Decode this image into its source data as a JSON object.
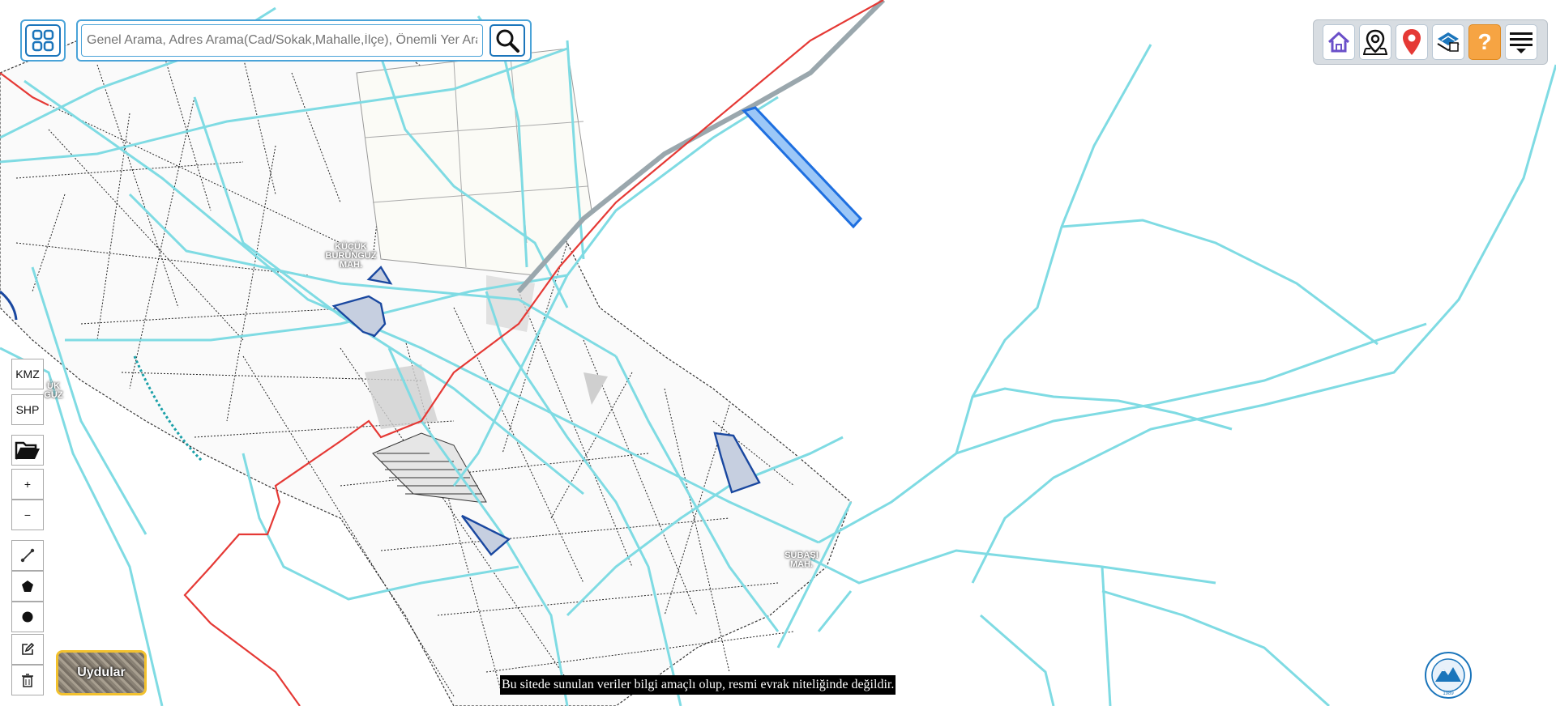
{
  "search": {
    "placeholder": "Genel Arama, Adres Arama(Cad/Sokak,Mahalle,İlçe), Önemli Yer Arama"
  },
  "toolbar": {
    "icons": [
      "home-icon",
      "map-pin-outline-icon",
      "location-pin-icon",
      "layers-icon",
      "help-icon",
      "menu-icon"
    ],
    "help_label": "?"
  },
  "left_controls": {
    "kmz_label": "KMZ",
    "shp_label": "SHP",
    "zoom_in_label": "+",
    "zoom_out_label": "−"
  },
  "basemap": {
    "button_label": "Uydular"
  },
  "map": {
    "labels": {
      "kucuk_buruncuz": "KÜÇÜK BURUNGUZ MAH.",
      "subasi": "SUBAŞI MAH.",
      "edge_fragment": "ÜK GÜZ"
    },
    "colors": {
      "roads": "#7fdbe3",
      "boundary": "#e53935",
      "parcels": "#222222",
      "selection": "#1565c0",
      "highlight_fill": "#9cc7f7"
    }
  },
  "disclaimer": "Bu sitede sunulan veriler bilgi amaçlı olup, resmi evrak niteliğinde değildir.",
  "logo": {
    "year": "1989"
  }
}
